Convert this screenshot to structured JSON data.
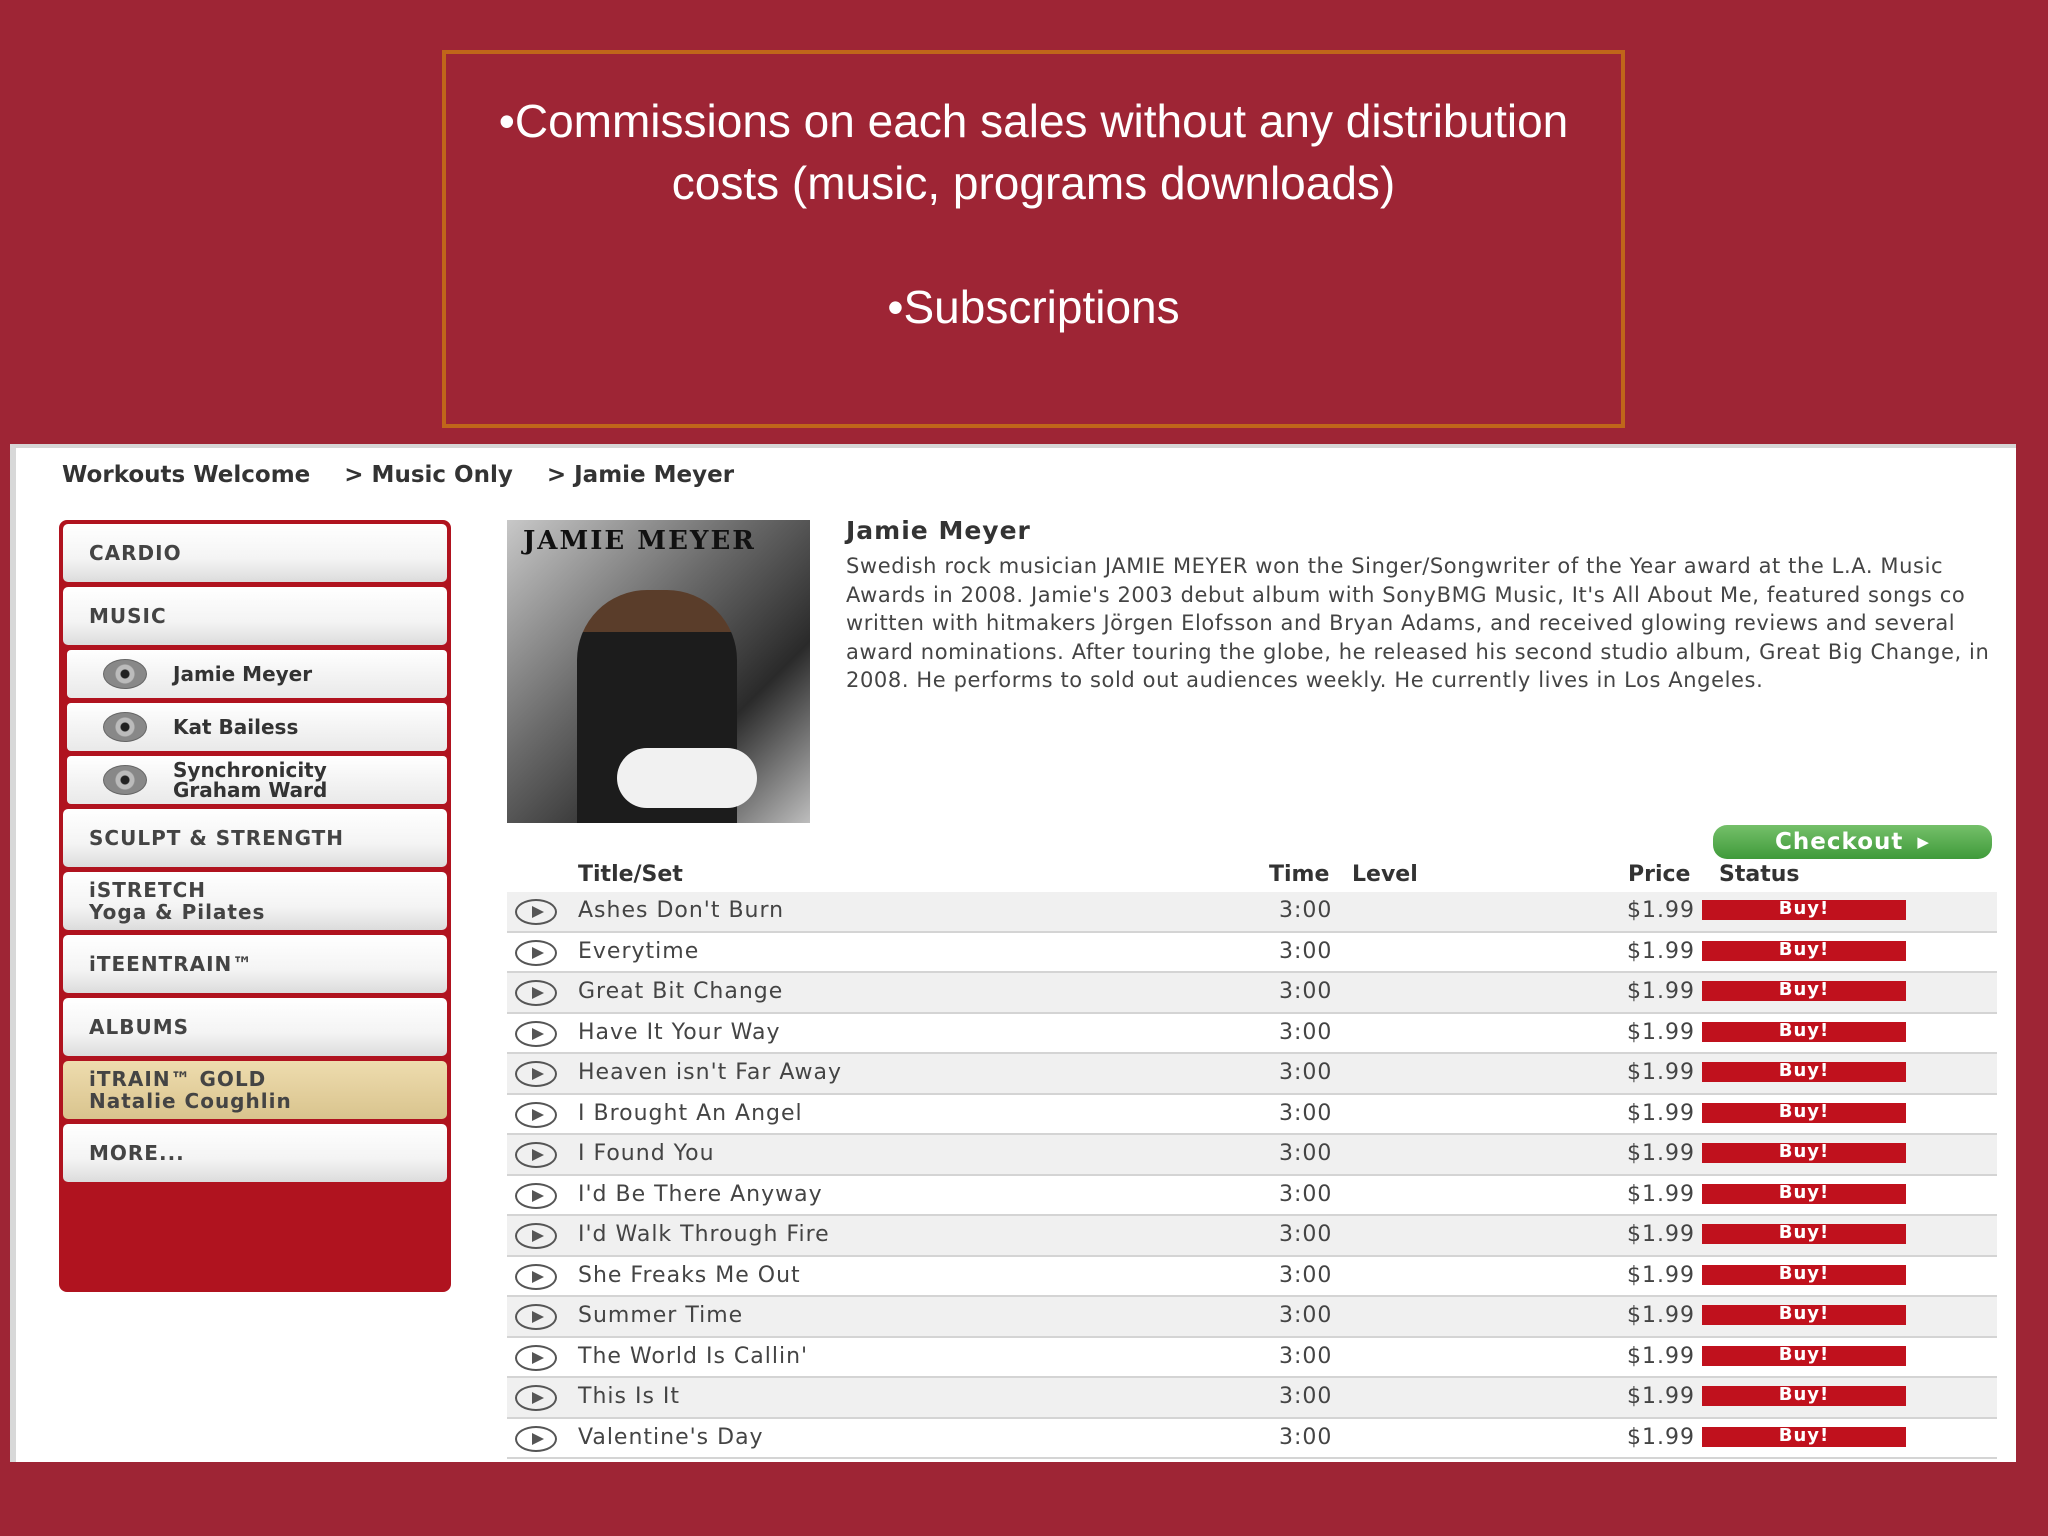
{
  "slide": {
    "bullet1": "•Commissions on each sales without any distribution costs (music, programs downloads)",
    "bullet2": "•Subscriptions"
  },
  "breadcrumb": {
    "item1": "Workouts Welcome",
    "item2": "> Music Only",
    "item3": "> Jamie Meyer"
  },
  "sidebar": {
    "cardio": "CARDIO",
    "music": "MUSIC",
    "sub1": "Jamie Meyer",
    "sub2": "Kat Bailess",
    "sub3_line1": "Synchronicity",
    "sub3_line2": "Graham Ward",
    "sculpt": "SCULPT & STRENGTH",
    "istretch_line1": "iSTRETCH",
    "istretch_line2": "Yoga & Pilates",
    "iteen": "iTEENTRAIN™",
    "albums": "ALBUMS",
    "gold_line1": "iTRAIN™ GOLD",
    "gold_line2": "Natalie Coughlin",
    "more": "MORE..."
  },
  "artist": {
    "cover_text": "JAMIE MEYER",
    "name": "Jamie Meyer",
    "bio": "Swedish rock musician JAMIE MEYER won the Singer/Songwriter of the Year award at the L.A. Music Awards in 2008. Jamie's 2003 debut album with SonyBMG Music, It's All About Me, featured songs co written with hitmakers Jörgen Elofsson and Bryan Adams, and received glowing reviews and several award nominations. After touring the globe, he released his second studio album, Great Big Change, in 2008. He performs to sold out audiences weekly. He currently lives in Los Angeles."
  },
  "checkout_label": "Checkout",
  "table": {
    "headers": {
      "title": "Title/Set",
      "time": "Time",
      "level": "Level",
      "price": "Price",
      "status": "Status"
    },
    "rows": [
      {
        "title": "Ashes Don't Burn",
        "time": "3:00",
        "price": "$1.99",
        "status": "Buy!"
      },
      {
        "title": "Everytime",
        "time": "3:00",
        "price": "$1.99",
        "status": "Buy!"
      },
      {
        "title": "Great Bit Change",
        "time": "3:00",
        "price": "$1.99",
        "status": "Buy!"
      },
      {
        "title": "Have It Your Way",
        "time": "3:00",
        "price": "$1.99",
        "status": "Buy!"
      },
      {
        "title": "Heaven isn't Far Away",
        "time": "3:00",
        "price": "$1.99",
        "status": "Buy!"
      },
      {
        "title": "I Brought An Angel",
        "time": "3:00",
        "price": "$1.99",
        "status": "Buy!"
      },
      {
        "title": "I Found You",
        "time": "3:00",
        "price": "$1.99",
        "status": "Buy!"
      },
      {
        "title": "I'd Be There Anyway",
        "time": "3:00",
        "price": "$1.99",
        "status": "Buy!"
      },
      {
        "title": "I'd Walk Through Fire",
        "time": "3:00",
        "price": "$1.99",
        "status": "Buy!"
      },
      {
        "title": "She Freaks Me Out",
        "time": "3:00",
        "price": "$1.99",
        "status": "Buy!"
      },
      {
        "title": "Summer Time",
        "time": "3:00",
        "price": "$1.99",
        "status": "Buy!"
      },
      {
        "title": "The World Is Callin'",
        "time": "3:00",
        "price": "$1.99",
        "status": "Buy!"
      },
      {
        "title": "This Is It",
        "time": "3:00",
        "price": "$1.99",
        "status": "Buy!"
      },
      {
        "title": "Valentine's Day",
        "time": "3:00",
        "price": "$1.99",
        "status": "Buy!"
      }
    ]
  }
}
